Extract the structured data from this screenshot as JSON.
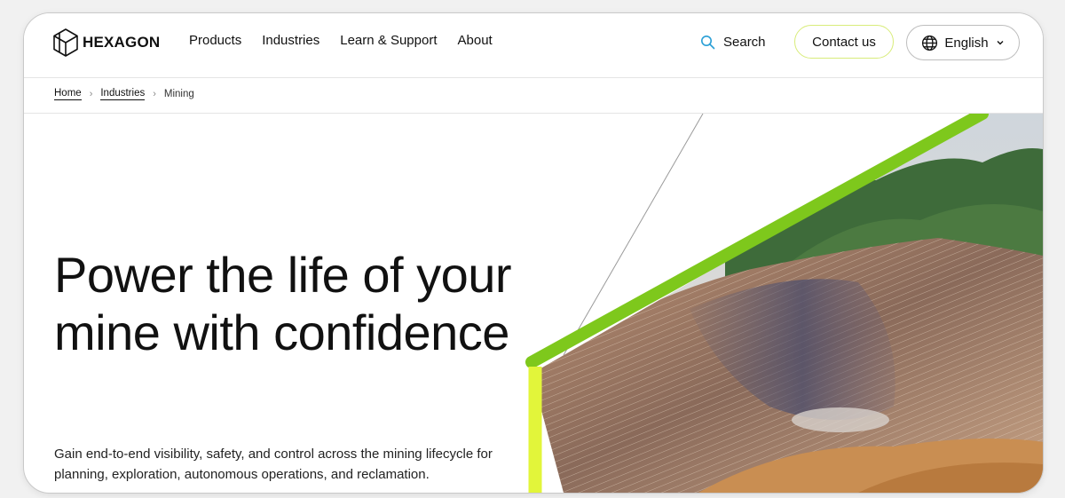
{
  "brand": {
    "name": "HEXAGON"
  },
  "nav": {
    "items": [
      "Products",
      "Industries",
      "Learn & Support",
      "About"
    ]
  },
  "header": {
    "search_label": "Search",
    "contact_label": "Contact us",
    "language_label": "English"
  },
  "breadcrumb": {
    "items": [
      "Home",
      "Industries"
    ],
    "current": "Mining"
  },
  "hero": {
    "title": "Power the life of your mine with confidence",
    "description": "Gain end-to-end visibility, safety, and control across the mining lifecycle for planning, exploration, autonomous operations, and reclamation."
  },
  "colors": {
    "accent_green": "#7ec81c",
    "accent_lime": "#e2f53a",
    "contact_border": "#d8ec7a"
  },
  "icons": [
    "hexagon-logo-icon",
    "search-icon",
    "globe-icon",
    "chevron-down-icon",
    "breadcrumb-chevron-icon"
  ]
}
